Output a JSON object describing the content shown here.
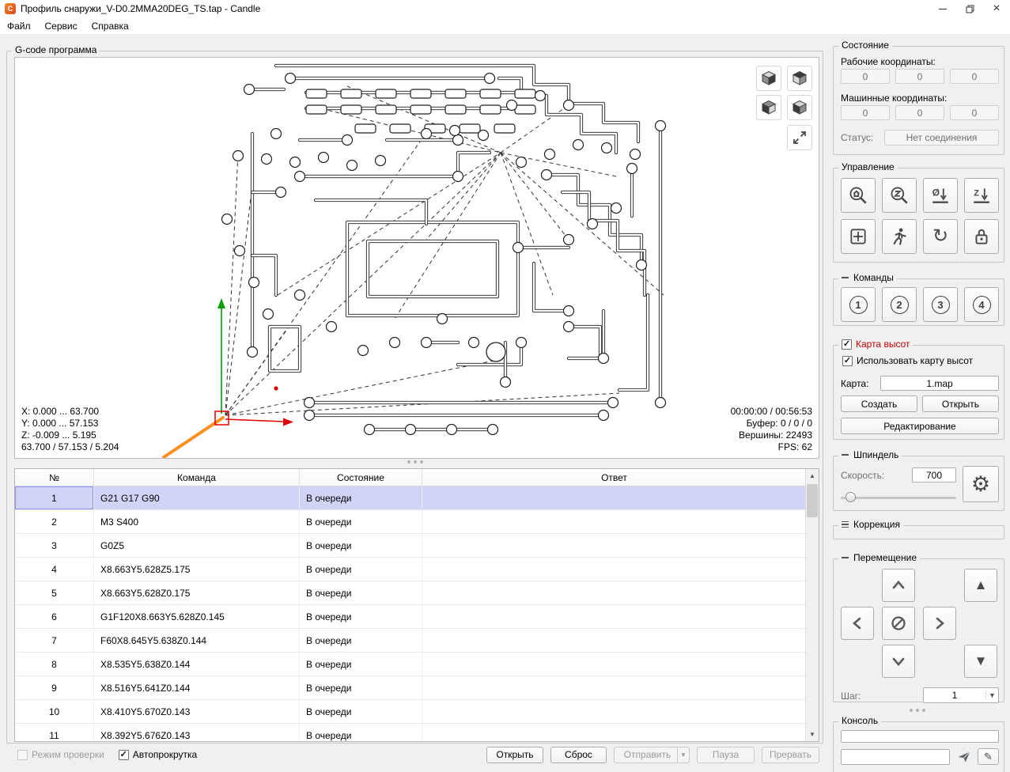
{
  "window": {
    "title": "Профиль снаружи_V-D0.2MMA20DEG_TS.tap - Candle"
  },
  "menu": [
    "Файл",
    "Сервис",
    "Справка"
  ],
  "gcode_group": {
    "title": "G-code программа"
  },
  "viewer": {
    "info": {
      "x": "X: 0.000 ... 63.700",
      "y": "Y: 0.000 ... 57.153",
      "z": "Z: -0.009 ... 5.195",
      "dims": "63.700 / 57.153 / 5.204"
    },
    "stats": {
      "time": "00:00:00 / 00:56:53",
      "buffer": "Буфер: 0 / 0 / 0",
      "vertices": "Вершины: 22493",
      "fps": "FPS: 62"
    }
  },
  "program_table": {
    "headers": [
      "№",
      "Команда",
      "Состояние",
      "Ответ"
    ],
    "selected_row": 0,
    "rows": [
      {
        "n": "1",
        "command": "G21 G17 G90",
        "state": "В очереди",
        "response": ""
      },
      {
        "n": "2",
        "command": "M3 S400",
        "state": "В очереди",
        "response": ""
      },
      {
        "n": "3",
        "command": "G0Z5",
        "state": "В очереди",
        "response": ""
      },
      {
        "n": "4",
        "command": "X8.663Y5.628Z5.175",
        "state": "В очереди",
        "response": ""
      },
      {
        "n": "5",
        "command": "X8.663Y5.628Z0.175",
        "state": "В очереди",
        "response": ""
      },
      {
        "n": "6",
        "command": "G1F120X8.663Y5.628Z0.145",
        "state": "В очереди",
        "response": ""
      },
      {
        "n": "7",
        "command": "F60X8.645Y5.638Z0.144",
        "state": "В очереди",
        "response": ""
      },
      {
        "n": "8",
        "command": "X8.535Y5.638Z0.144",
        "state": "В очереди",
        "response": ""
      },
      {
        "n": "9",
        "command": "X8.516Y5.641Z0.144",
        "state": "В очереди",
        "response": ""
      },
      {
        "n": "10",
        "command": "X8.410Y5.670Z0.143",
        "state": "В очереди",
        "response": ""
      },
      {
        "n": "11",
        "command": "X8.392Y5.676Z0.143",
        "state": "В очереди",
        "response": ""
      }
    ]
  },
  "bottom_bar": {
    "check_mode_label": "Режим проверки",
    "autoscroll_label": "Автопрокрутка",
    "open": "Открыть",
    "reset": "Сброс",
    "send": "Отправить",
    "pause": "Пауза",
    "abort": "Прервать"
  },
  "status_group": {
    "title": "Состояние",
    "work_label": "Рабочие координаты:",
    "machine_label": "Машинные координаты:",
    "work": [
      "0",
      "0",
      "0"
    ],
    "machine": [
      "0",
      "0",
      "0"
    ],
    "status_label": "Статус:",
    "status_value": "Нет соединения"
  },
  "control_group": {
    "title": "Управление"
  },
  "commands_group": {
    "title": "Команды",
    "buttons": [
      "1",
      "2",
      "3",
      "4"
    ]
  },
  "heightmap_group": {
    "title": "Карта высот",
    "use_label": "Использовать карту высот",
    "map_label": "Карта:",
    "map_value": "1.map",
    "create": "Создать",
    "open": "Открыть",
    "edit": "Редактирование"
  },
  "spindle_group": {
    "title": "Шпиндель",
    "speed_label": "Скорость:",
    "speed_value": "700"
  },
  "correction_group": {
    "title": "Коррекция"
  },
  "jog_group": {
    "title": "Перемещение",
    "step_label": "Шаг:",
    "step_value": "1"
  },
  "console_group": {
    "title": "Консоль"
  },
  "accent_colors": {
    "heightmap_title": "#c00000",
    "selection": "#d2d4f7"
  }
}
